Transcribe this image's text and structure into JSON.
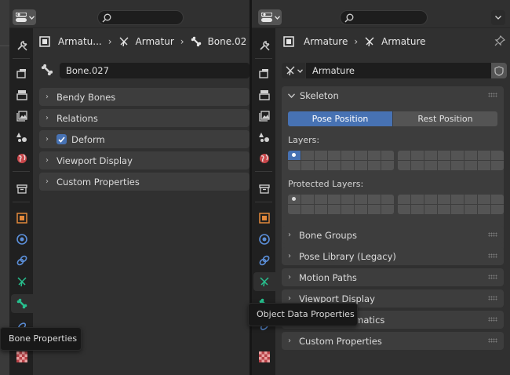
{
  "left": {
    "breadcrumb": [
      "Armatu...",
      "Armatur",
      "Bone.02"
    ],
    "bone_name": "Bone.027",
    "panels": [
      {
        "label": "Bendy Bones",
        "checkbox": false
      },
      {
        "label": "Relations",
        "checkbox": false
      },
      {
        "label": "Deform",
        "checkbox": true
      },
      {
        "label": "Viewport Display",
        "checkbox": false
      },
      {
        "label": "Custom Properties",
        "checkbox": false
      }
    ],
    "tooltip": "Bone Properties"
  },
  "right": {
    "breadcrumb": [
      "Armature",
      "Armature"
    ],
    "data_name": "Armature",
    "skeleton": {
      "title": "Skeleton",
      "pose_position": "Pose Position",
      "rest_position": "Rest Position",
      "layers_label": "Layers:",
      "protected_label": "Protected Layers:"
    },
    "panels": [
      "Bone Groups",
      "Pose Library (Legacy)",
      "Motion Paths",
      "Viewport Display",
      "Inverse Kinematics",
      "Custom Properties"
    ],
    "tooltip": "Object Data Properties"
  },
  "colors": {
    "accent": "#4772b3",
    "bone_tab": "#27c08e",
    "object_orange": "#e3893b",
    "constraint_blue": "#5b8fd9"
  }
}
